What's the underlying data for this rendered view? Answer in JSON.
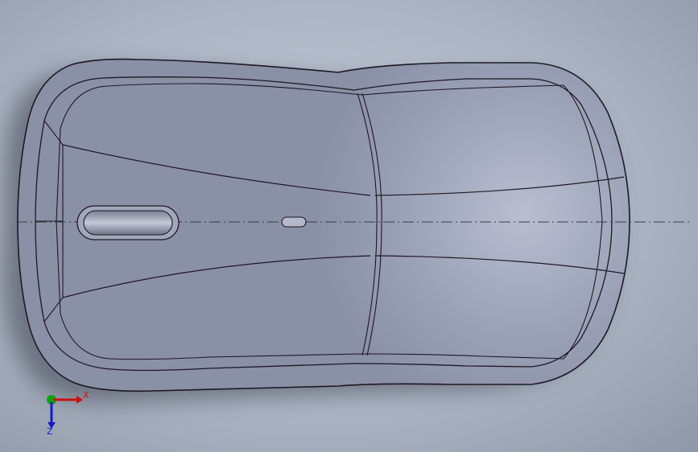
{
  "viewport": {
    "background_top": "#c9d0dc",
    "background_bottom": "#8f98a8",
    "model_color": "#9aa0b5",
    "edge_color": "#1a1a22"
  },
  "triad": {
    "x_label": "X",
    "z_label": "Z",
    "x_color": "#d01010",
    "y_color": "#10a010",
    "z_color": "#1020c0"
  }
}
